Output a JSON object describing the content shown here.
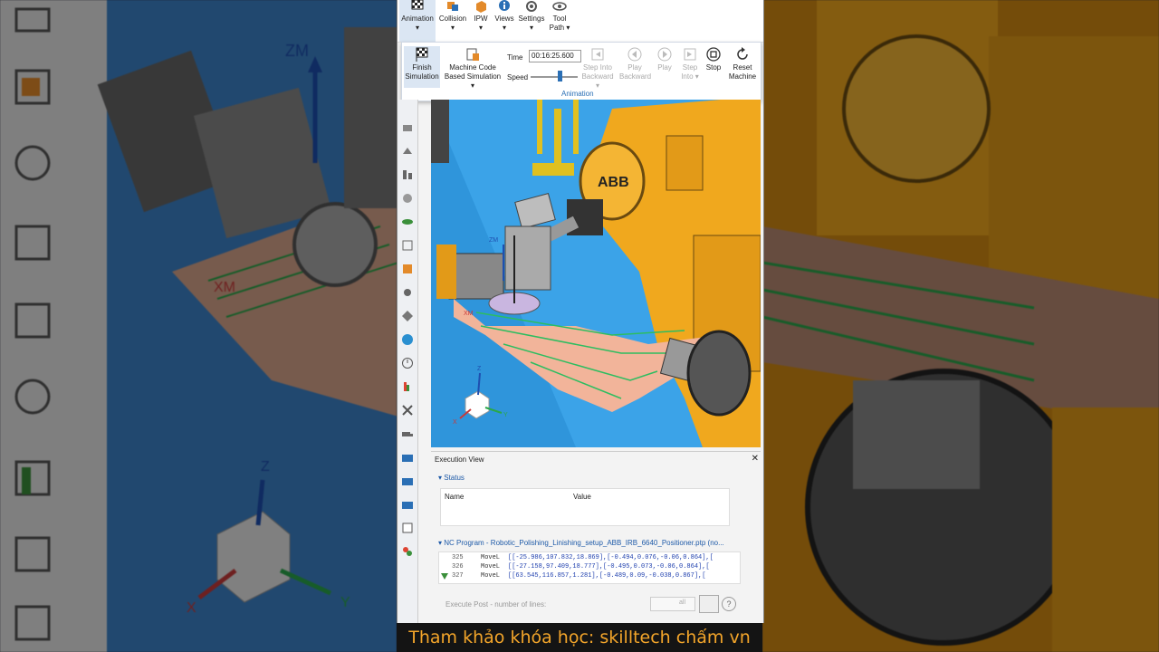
{
  "ribbon": {
    "tabs": [
      {
        "label": "Animation",
        "sub": "▾"
      },
      {
        "label": "Collision",
        "sub": "▾"
      },
      {
        "label": "IPW",
        "sub": "▾"
      },
      {
        "label": "Views",
        "sub": "▾"
      },
      {
        "label": "Settings",
        "sub": "▾"
      },
      {
        "label": "Tool",
        "sub": "Path ▾"
      }
    ]
  },
  "panel": {
    "finish_line1": "Finish",
    "finish_line2": "Simulation",
    "mcbs_line1": "Machine Code",
    "mcbs_line2": "Based Simulation ▾",
    "time_label": "Time",
    "time_value": "00:16:25.600",
    "speed_label": "Speed",
    "step_back_line1": "Step Into",
    "step_back_line2": "Backward ▾",
    "play_back_line1": "Play",
    "play_back_line2": "Backward",
    "play_label": "Play",
    "step_into_line1": "Step",
    "step_into_line2": "Into ▾",
    "stop_label": "Stop",
    "reset_line1": "Reset",
    "reset_line2": "Machine",
    "group_label": "Animation"
  },
  "viewport": {
    "axis_zm": "ZM",
    "axis_xm": "XM",
    "triad_z": "Z",
    "triad_x": "X",
    "triad_y": "Y"
  },
  "background": {
    "axis_zm": "ZM",
    "axis_xm": "XM",
    "triad_z": "Z",
    "triad_x": "X",
    "triad_y": "Y"
  },
  "execution": {
    "title": "Execution View",
    "close": "✕",
    "status_header": "▾  Status",
    "col_name": "Name",
    "col_value": "Value",
    "nc_header": "▾  NC Program - Robotic_Polishing_Linishing_setup_ABB_IRB_6640_Positioner.ptp (no...",
    "nc_lines": [
      {
        "num": "325",
        "cmd": "MoveL",
        "args": "[[-25.986,107.832,18.869],[-0.494,0.076,-0.06,0.864],["
      },
      {
        "num": "326",
        "cmd": "MoveL",
        "args": "[[-27.158,97.409,18.777],[-0.495,0.073,-0.06,0.864],["
      },
      {
        "num": "327",
        "cmd": "MoveL",
        "args": "[[63.545,116.857,1.281],[-0.489,0.09,-0.038,0.867],["
      }
    ],
    "exec_post": "Execute Post - number of lines:",
    "lines_all": "all",
    "help": "?"
  },
  "banner": {
    "text": "Tham khảo khóa học: skilltech chấm vn"
  },
  "colors": {
    "accent": "#2a6fb5",
    "banner_text": "#f3a52a",
    "robot_orange": "#f0a81e",
    "viewport_bg": "#3ba3e8"
  }
}
